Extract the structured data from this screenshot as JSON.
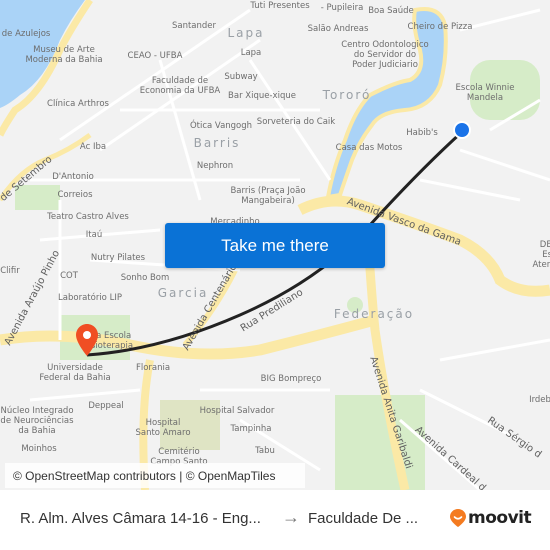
{
  "map": {
    "neighborhoods": [
      {
        "name": "Lapa"
      },
      {
        "name": "Barris"
      },
      {
        "name": "Tororó"
      },
      {
        "name": "Garcia"
      },
      {
        "name": "Federação"
      }
    ],
    "streets": [
      {
        "name": "Avenida Sete de Setembro",
        "display": "de Setembro"
      },
      {
        "name": "Avenida Araújo Pinho",
        "display": "Avenida Araújo Pinho"
      },
      {
        "name": "Avenida Centenário",
        "display": "Avenida Centenário"
      },
      {
        "name": "Rua Prediliano",
        "display": "Rua Prediliano"
      },
      {
        "name": "Avenida Vasco da Gama",
        "display": "Avenida Vasco da Gama"
      },
      {
        "name": "Avenida Anita Garibaldi",
        "display": "Avenida Anita Garibaldi"
      },
      {
        "name": "Avenida Cardeal da Silva",
        "display": "Avenida Cardeal d"
      },
      {
        "name": "Rua Sérgio de Carvalho",
        "display": "Rua Sérgio d"
      }
    ],
    "places": [
      {
        "name": "u de Azulejos"
      },
      {
        "name": "Museu de Arte\nModerna da Bahia"
      },
      {
        "name": "Santander"
      },
      {
        "name": "Tuti Presentes"
      },
      {
        "name": "- Pupileira"
      },
      {
        "name": "Boa Saúde"
      },
      {
        "name": "Cheiro de Pizza"
      },
      {
        "name": "Salão Andreas"
      },
      {
        "name": "Centro Odontologico\ndo Servidor do\nPoder Judiciario"
      },
      {
        "name": "CEAO - UFBA"
      },
      {
        "name": "Lapa"
      },
      {
        "name": "Faculdade de\nEconomia da UFBA"
      },
      {
        "name": "Subway"
      },
      {
        "name": "Bar Xique-xique"
      },
      {
        "name": "Clínica Arthros"
      },
      {
        "name": "Ótica Vangogh"
      },
      {
        "name": "Sorveteria do Caik"
      },
      {
        "name": "Escola Winnie\nMandela"
      },
      {
        "name": "Habib's"
      },
      {
        "name": "Ac Iba"
      },
      {
        "name": "Casa das Motos"
      },
      {
        "name": "Nephron"
      },
      {
        "name": "D'Antonio"
      },
      {
        "name": "Barris (Praça João\nMangabeira)"
      },
      {
        "name": "Correios"
      },
      {
        "name": "Teatro Castro Alves"
      },
      {
        "name": "Mercadinho"
      },
      {
        "name": "Itaú"
      },
      {
        "name": "Nutry Pilates"
      },
      {
        "name": "Clifir"
      },
      {
        "name": "COT"
      },
      {
        "name": "Sonho Bom"
      },
      {
        "name": "Laboratório LIP"
      },
      {
        "name": "DEA\nEsp\nAtend"
      },
      {
        "name": "ta Escola\nsioterapia"
      },
      {
        "name": "Universidade\nFederal da Bahia"
      },
      {
        "name": "Florania"
      },
      {
        "name": "BIG Bompreço"
      },
      {
        "name": "Deppeal"
      },
      {
        "name": "Núcleo Integrado\nde Neurociências\nda Bahia"
      },
      {
        "name": "Hospital Salvador"
      },
      {
        "name": "Hospital\nSanto Amaro"
      },
      {
        "name": "Tampinha"
      },
      {
        "name": "Irdeb"
      },
      {
        "name": "Moinhos"
      },
      {
        "name": "Cemitério\nCampo Santo"
      },
      {
        "name": "Tabu"
      }
    ],
    "route": {
      "origin_marker": "current-location-dot",
      "destination_marker": "map-pin",
      "color": "#222222"
    },
    "colors": {
      "water": "#aad3f7",
      "land": "#f2f2f2",
      "major_road": "#fbe9a6",
      "park": "#d6ecc8",
      "button": "#0a72d6",
      "origin_dot": "#1a73e8",
      "destination_pin": "#f04e23"
    }
  },
  "cta": {
    "label": "Take me there"
  },
  "attribution": "© OpenStreetMap contributors | © OpenMapTiles",
  "footer": {
    "origin": "R. Alm. Alves Câmara 14-16 - Eng...",
    "arrow": "→",
    "destination": "Faculdade De ...",
    "brand": "moovit",
    "brand_color": "#f47b20"
  }
}
